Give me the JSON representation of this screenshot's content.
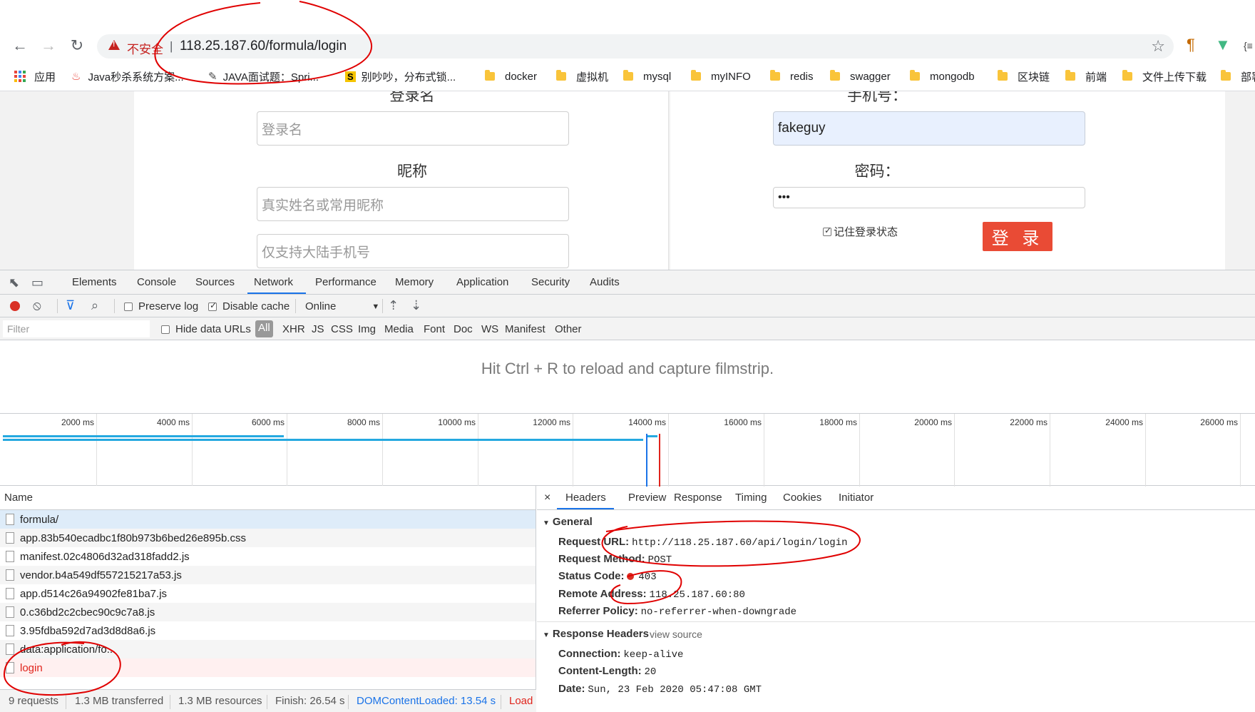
{
  "browser": {
    "omnibox": {
      "security_label": "不安全",
      "separator": "|",
      "url": "118.25.187.60/formula/login"
    },
    "bookmarks": [
      "应用",
      "Java秒杀系统方案...",
      "JAVA面试题：Spri...",
      "别吵吵，分布式锁...",
      "docker",
      "虚拟机",
      "mysql",
      "myINFO",
      "redis",
      "swagger",
      "mongodb",
      "区块链",
      "前端",
      "文件上传下载",
      "部署"
    ]
  },
  "page": {
    "left": {
      "label_username": "登录名",
      "username_placeholder": "登录名",
      "label_nickname": "昵称",
      "nickname_placeholder": "真实姓名或常用昵称",
      "phone_placeholder": "仅支持大陆手机号"
    },
    "right": {
      "label_phone": "手机号：",
      "phone_value": "fakeguy",
      "label_password": "密码：",
      "password_value": "•••",
      "remember_label": "记住登录状态",
      "login_button": "登 录"
    }
  },
  "devtools": {
    "tabs": [
      "Elements",
      "Console",
      "Sources",
      "Network",
      "Performance",
      "Memory",
      "Application",
      "Security",
      "Audits"
    ],
    "active_tab": "Network",
    "toolbar": {
      "preserve_log": "Preserve log",
      "preserve_log_checked": false,
      "disable_cache": "Disable cache",
      "disable_cache_checked": true,
      "throttle": "Online"
    },
    "filter": {
      "placeholder": "Filter",
      "hide_data_urls": "Hide data URLs",
      "types": [
        "All",
        "XHR",
        "JS",
        "CSS",
        "Img",
        "Media",
        "Font",
        "Doc",
        "WS",
        "Manifest",
        "Other"
      ],
      "active_type": "All"
    },
    "filmstrip_message": "Hit Ctrl + R to reload and capture filmstrip.",
    "timeline_ticks": [
      "2000 ms",
      "4000 ms",
      "6000 ms",
      "8000 ms",
      "10000 ms",
      "12000 ms",
      "14000 ms",
      "16000 ms",
      "18000 ms",
      "20000 ms",
      "22000 ms",
      "24000 ms",
      "26000 ms"
    ],
    "requests": {
      "header": "Name",
      "rows": [
        {
          "name": "formula/",
          "state": "selected"
        },
        {
          "name": "app.83b540ecadbc1f80b973b6bed26e895b.css",
          "state": "normal"
        },
        {
          "name": "manifest.02c4806d32ad318fadd2.js",
          "state": "normal"
        },
        {
          "name": "vendor.b4a549df557215217a53.js",
          "state": "normal"
        },
        {
          "name": "app.d514c26a94902fe81ba7.js",
          "state": "normal"
        },
        {
          "name": "0.c36bd2c2cbec90c9c7a8.js",
          "state": "normal"
        },
        {
          "name": "3.95fdba592d7ad3d8d8a6.js",
          "state": "normal"
        },
        {
          "name": "data:application/fo...",
          "state": "normal"
        },
        {
          "name": "login",
          "state": "error"
        }
      ]
    },
    "status_bar": {
      "requests": "9 requests",
      "transferred": "1.3 MB transferred",
      "resources": "1.3 MB resources",
      "finish": "Finish: 26.54 s",
      "dom_loaded": "DOMContentLoaded: 13.54 s",
      "load": "Load"
    },
    "detail": {
      "tabs": [
        "Headers",
        "Preview",
        "Response",
        "Timing",
        "Cookies",
        "Initiator"
      ],
      "active_tab": "Headers",
      "general_title": "General",
      "request_url_key": "Request URL:",
      "request_url": "http://118.25.187.60/api/login/login",
      "request_method_key": "Request Method:",
      "request_method": "POST",
      "status_code_key": "Status Code:",
      "status_code": "403",
      "remote_address_key": "Remote Address:",
      "remote_address": "118.25.187.60:80",
      "referrer_policy_key": "Referrer Policy:",
      "referrer_policy": "no-referrer-when-downgrade",
      "response_headers_title": "Response Headers",
      "view_source": "view source",
      "connection_key": "Connection:",
      "connection": "keep-alive",
      "content_length_key": "Content-Length:",
      "content_length": "20",
      "date_key": "Date:",
      "date": "Sun, 23 Feb 2020 05:47:08 GMT"
    }
  },
  "colors": {
    "accent": "#1a73e8",
    "insecure_red": "#c5221f",
    "login_button": "#e94b35",
    "annotation_red": "#e00000"
  }
}
